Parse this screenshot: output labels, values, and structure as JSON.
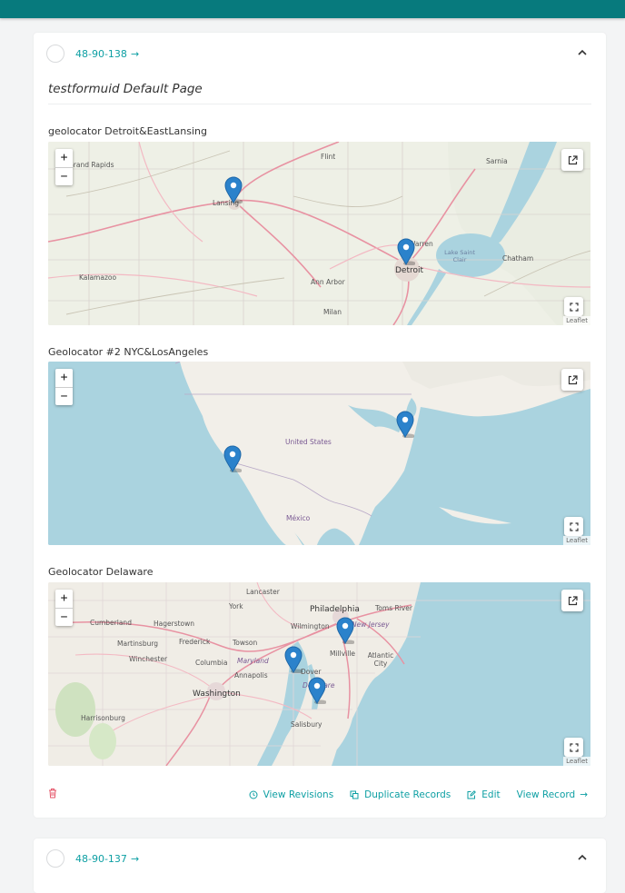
{
  "records": [
    {
      "id": "48-90-138",
      "page_title": "testformuid Default Page",
      "fields": [
        {
          "label": "geolocator Detroit&EastLansing",
          "place_labels": [
            "Flint",
            "Sarnia",
            "Grand Rapids",
            "Lansing",
            "Warren",
            "Lake Saint Clair",
            "Detroit",
            "Chatham",
            "Kalamazoo",
            "Ann Arbor",
            "Milan"
          ]
        },
        {
          "label": "Geolocator #2 NYC&LosAngeles",
          "place_labels": [
            "United States",
            "México"
          ]
        },
        {
          "label": "Geolocator Delaware",
          "place_labels": [
            "Lancaster",
            "York",
            "Philadelphia",
            "Toms River",
            "Cumberland",
            "Hagerstown",
            "Wilmington",
            "New Jersey",
            "Martinsburg",
            "Frederick",
            "Towson",
            "Millville",
            "Atlantic City",
            "Winchester",
            "Columbia",
            "Maryland",
            "Annapolis",
            "Dover",
            "Washington",
            "Delaware",
            "Harrisonburg",
            "Salisbury"
          ]
        }
      ],
      "map_controls": {
        "zoom_in": "+",
        "zoom_out": "−",
        "attribution": "Leaflet"
      },
      "actions": {
        "view_revisions": "View Revisions",
        "duplicate": "Duplicate Records",
        "edit": "Edit",
        "view_record": "View Record"
      }
    },
    {
      "id": "48-90-137"
    }
  ],
  "colors": {
    "header": "#077a7d",
    "accent": "#0d9fa3",
    "delete": "#e5566a",
    "marker": "#2b82cb",
    "water": "#aad3df",
    "land": "#f2efe9"
  },
  "icons": {
    "collapse": "chevron-up-icon",
    "external": "external-link-icon",
    "fullscreen": "fullscreen-icon",
    "delete": "trash-icon",
    "revisions": "clock-icon",
    "duplicate": "copy-icon",
    "edit": "edit-icon",
    "view_record": "arrow-right-icon"
  }
}
